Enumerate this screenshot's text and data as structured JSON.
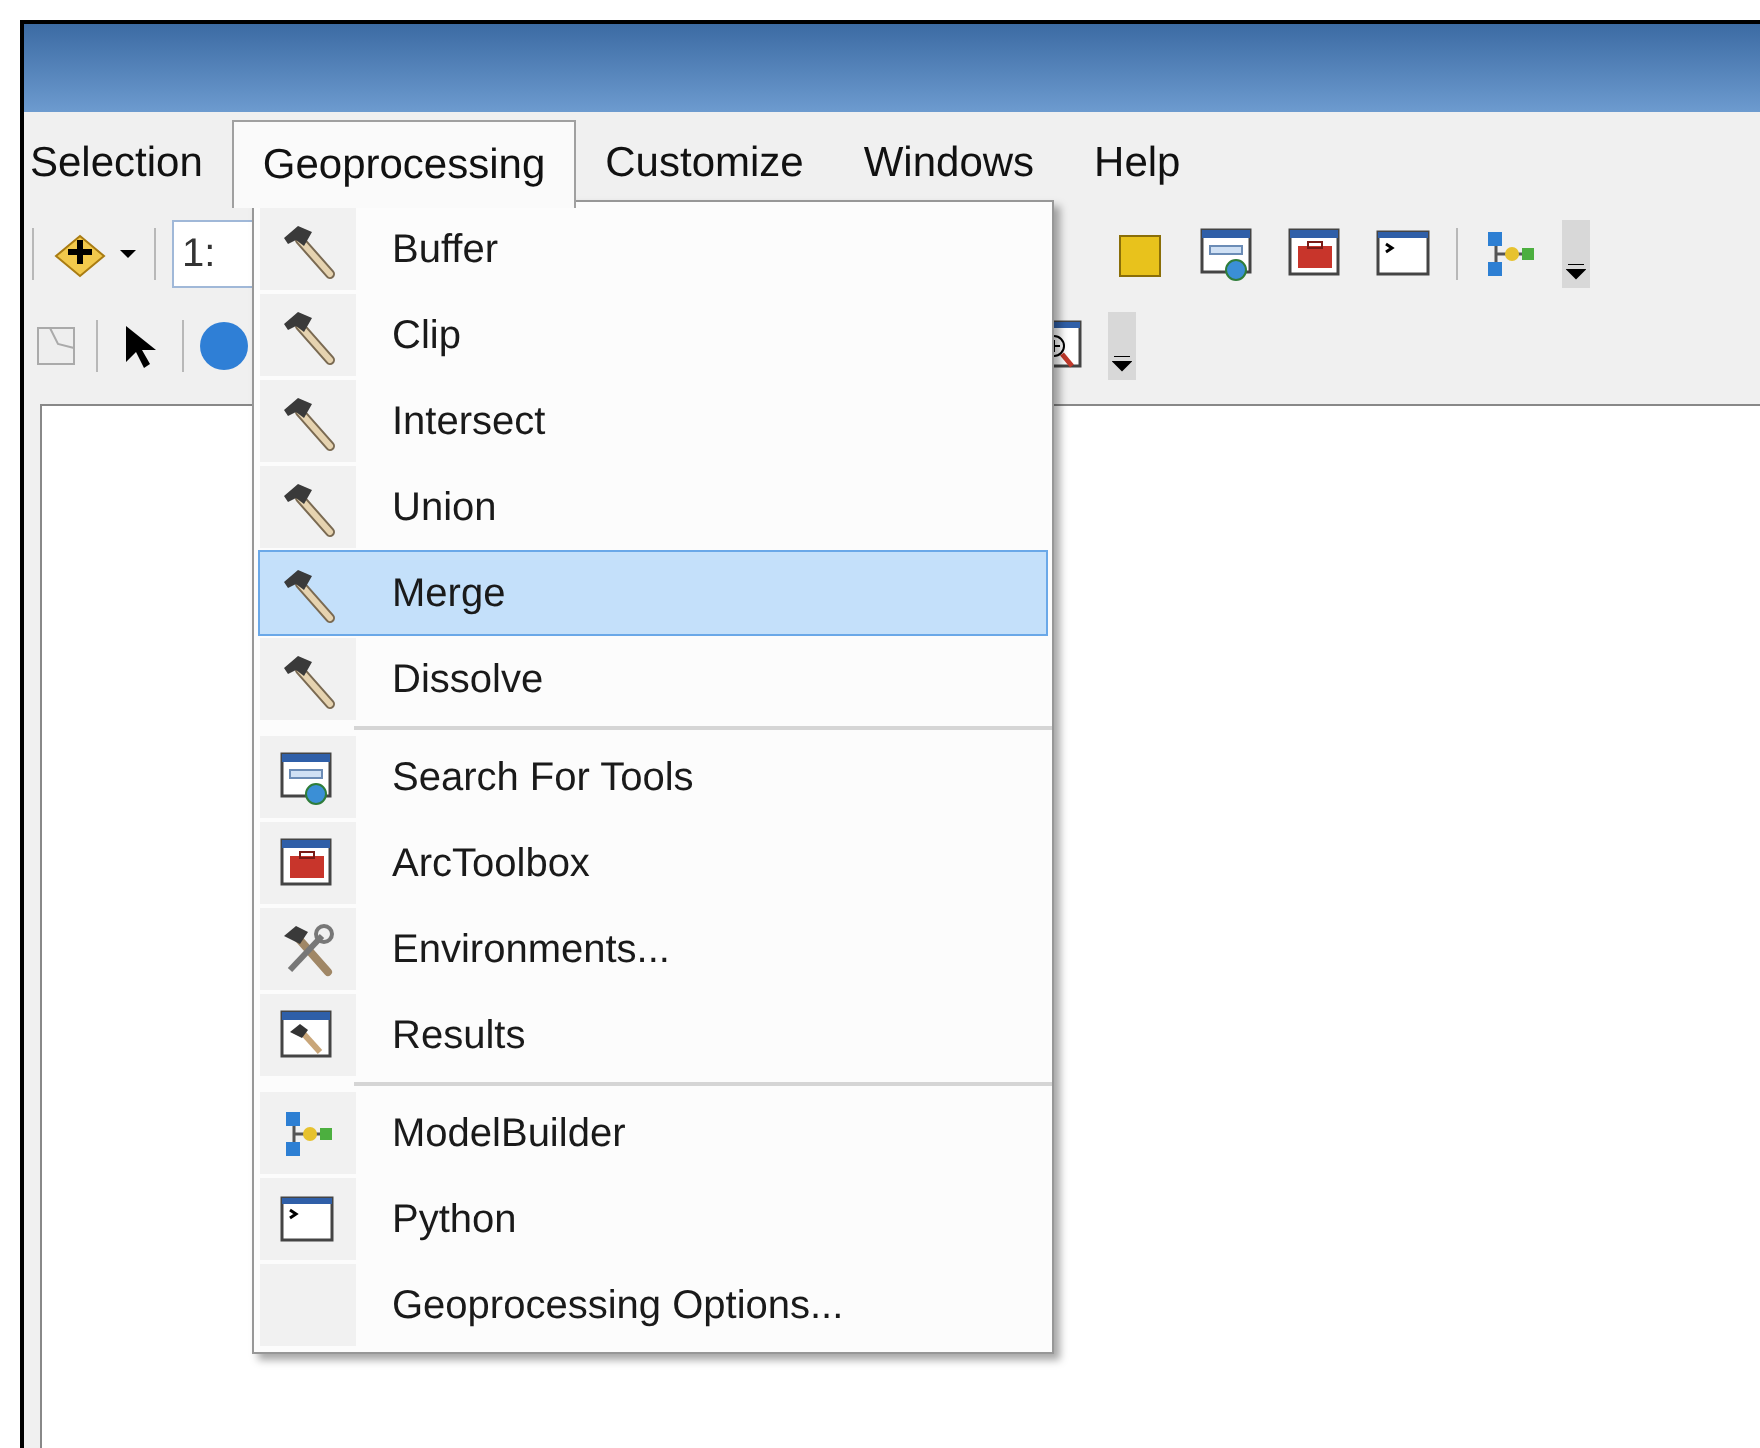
{
  "menu_bar": [
    {
      "label": "Selection",
      "selected": false
    },
    {
      "label": "Geoprocessing",
      "selected": true
    },
    {
      "label": "Customize",
      "selected": false
    },
    {
      "label": "Windows",
      "selected": false
    },
    {
      "label": "Help",
      "selected": false
    }
  ],
  "toolbar": {
    "scale_field": "1:"
  },
  "dropdown": {
    "groups": [
      [
        {
          "label": "Buffer",
          "kind": "hammer",
          "selected": false
        },
        {
          "label": "Clip",
          "kind": "hammer",
          "selected": false
        },
        {
          "label": "Intersect",
          "kind": "hammer",
          "selected": false
        },
        {
          "label": "Union",
          "kind": "hammer",
          "selected": false
        },
        {
          "label": "Merge",
          "kind": "hammer",
          "selected": true
        },
        {
          "label": "Dissolve",
          "kind": "hammer",
          "selected": false
        }
      ],
      [
        {
          "label": "Search For Tools",
          "kind": "search",
          "selected": false
        },
        {
          "label": "ArcToolbox",
          "kind": "toolbox",
          "selected": false
        },
        {
          "label": "Environments...",
          "kind": "tools",
          "selected": false
        },
        {
          "label": "Results",
          "kind": "results",
          "selected": false
        }
      ],
      [
        {
          "label": "ModelBuilder",
          "kind": "model",
          "selected": false
        },
        {
          "label": "Python",
          "kind": "python",
          "selected": false
        },
        {
          "label": "Geoprocessing Options...",
          "kind": "none",
          "selected": false
        }
      ]
    ]
  }
}
